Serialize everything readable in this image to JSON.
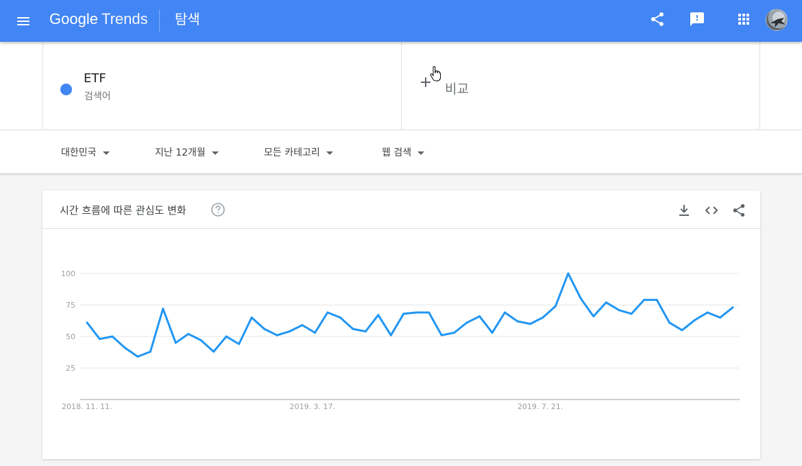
{
  "header": {
    "logo_google": "Google",
    "logo_trends": "Trends",
    "page_name": "탐색",
    "brand_color": "#4285f4",
    "icons": [
      "menu-icon",
      "share-icon",
      "feedback-icon",
      "apps-icon"
    ]
  },
  "search": {
    "term": "ETF",
    "term_type": "검색어",
    "term_color": "#4285f4",
    "compare_label": "비교"
  },
  "filters": [
    {
      "label": "대한민국"
    },
    {
      "label": "지난 12개월"
    },
    {
      "label": "모든 카테고리"
    },
    {
      "label": "웹 검색"
    }
  ],
  "interest_card": {
    "title": "시간 흐름에 따른 관심도 변화",
    "actions": [
      "download-icon",
      "embed-icon",
      "share-icon"
    ]
  },
  "chart_data": {
    "type": "line",
    "title": "",
    "xlabel": "",
    "ylabel": "",
    "ylim": [
      0,
      100
    ],
    "yticks": [
      25,
      50,
      75,
      100
    ],
    "grid": true,
    "x_tick_labels": [
      {
        "index": 0,
        "label": "2018. 11. 11."
      },
      {
        "index": 18,
        "label": "2019. 3. 17."
      },
      {
        "index": 36,
        "label": "2019. 7. 21."
      }
    ],
    "series": [
      {
        "name": "ETF",
        "color": "#2196f3",
        "values": [
          61,
          48,
          50,
          41,
          34,
          38,
          72,
          45,
          52,
          47,
          38,
          50,
          44,
          65,
          56,
          51,
          54,
          59,
          53,
          69,
          65,
          56,
          54,
          67,
          51,
          68,
          69,
          69,
          51,
          53,
          61,
          66,
          53,
          69,
          62,
          60,
          65,
          74,
          100,
          80,
          66,
          77,
          71,
          68,
          79,
          79,
          61,
          55,
          63,
          69,
          65,
          73
        ]
      }
    ]
  }
}
